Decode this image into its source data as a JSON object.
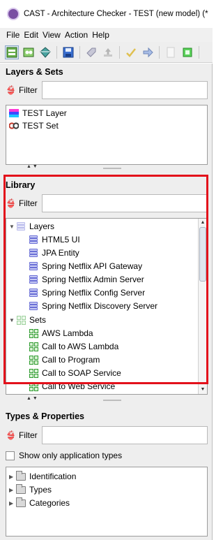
{
  "window": {
    "title": "CAST - Architecture Checker - TEST (new model) (*"
  },
  "menu": [
    "File",
    "Edit",
    "View",
    "Action",
    "Help"
  ],
  "toolbar": {
    "icons": [
      "add-layer-icon",
      "add-set-icon",
      "add-type-icon",
      "save-icon",
      "tag-icon",
      "upload-icon",
      "check-icon",
      "arrow-icon",
      "blank-page-icon",
      "green-page-icon"
    ]
  },
  "layers_sets": {
    "heading": "Layers & Sets",
    "filter_label": "Filter",
    "filter_value": "",
    "items": [
      {
        "label": "TEST Layer",
        "icon": "layer-color-icon"
      },
      {
        "label": "TEST Set",
        "icon": "set-goggles-icon"
      }
    ]
  },
  "library": {
    "heading": "Library",
    "filter_label": "Filter",
    "filter_value": "",
    "groups": [
      {
        "label": "Layers",
        "items": [
          "HTML5 UI",
          "JPA Entity",
          "Spring Netflix API Gateway",
          "Spring Netflix Admin Server",
          "Spring Netflix Config Server",
          "Spring Netflix Discovery Server"
        ]
      },
      {
        "label": "Sets",
        "items": [
          "AWS Lambda",
          "Call to AWS Lambda",
          "Call to Program",
          "Call to SOAP Service",
          "Call to Web Service"
        ]
      }
    ]
  },
  "types_properties": {
    "heading": "Types & Properties",
    "filter_label": "Filter",
    "filter_value": "",
    "checkbox_label": "Show only application types",
    "checkbox_checked": false,
    "items": [
      "Identification",
      "Types",
      "Categories"
    ]
  },
  "colors": {
    "highlight": "#e3111b",
    "panel_bg": "#eeeeee"
  }
}
